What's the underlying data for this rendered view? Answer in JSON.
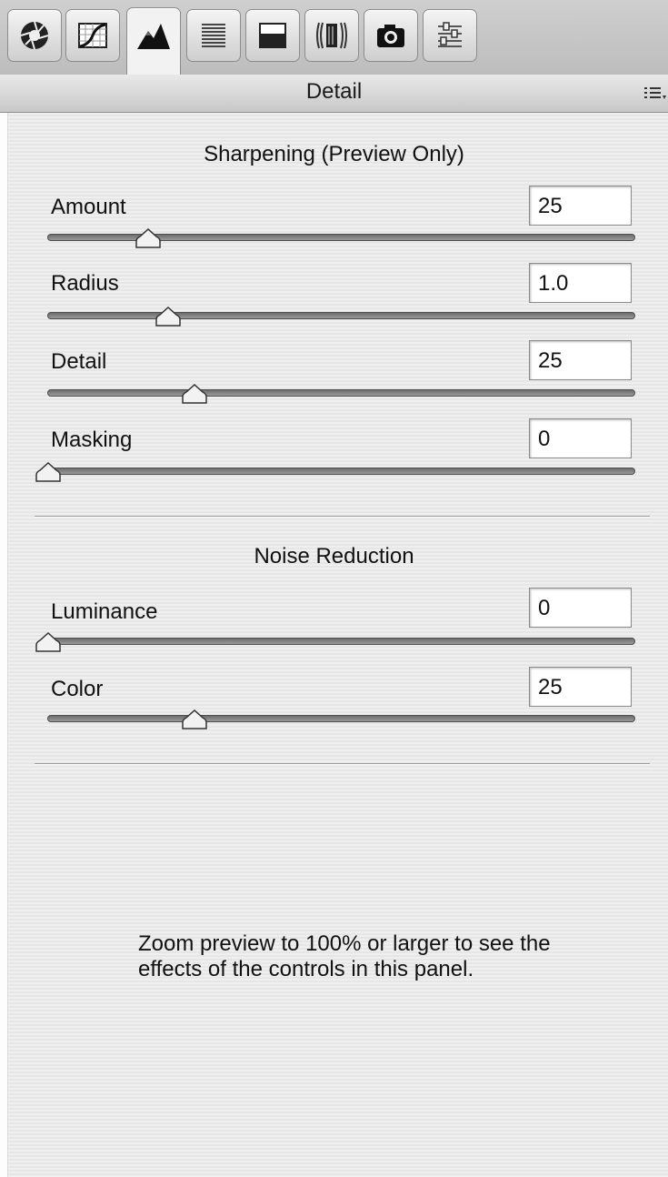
{
  "tabs": [
    {
      "name": "basic-tab",
      "icon": "aperture-icon"
    },
    {
      "name": "tone-curve-tab",
      "icon": "curve-icon"
    },
    {
      "name": "detail-tab",
      "icon": "mountain-icon",
      "active": true
    },
    {
      "name": "hsl-tab",
      "icon": "hsl-lines-icon"
    },
    {
      "name": "split-toning-tab",
      "icon": "split-toning-icon"
    },
    {
      "name": "lens-corrections-tab",
      "icon": "lens-icon"
    },
    {
      "name": "camera-calibration-tab",
      "icon": "camera-icon"
    },
    {
      "name": "presets-tab",
      "icon": "sliders-icon"
    }
  ],
  "header": {
    "title": "Detail",
    "menu_icon": "panel-menu-icon"
  },
  "sharpening": {
    "title": "Sharpening  (Preview Only)",
    "amount": {
      "label": "Amount",
      "value": "25",
      "fraction": 0.17
    },
    "radius": {
      "label": "Radius",
      "value": "1.0",
      "fraction": 0.205
    },
    "detail": {
      "label": "Detail",
      "value": "25",
      "fraction": 0.25
    },
    "masking": {
      "label": "Masking",
      "value": "0",
      "fraction": 0.0
    }
  },
  "noise_reduction": {
    "title": "Noise Reduction",
    "luminance": {
      "label": "Luminance",
      "value": "0",
      "fraction": 0.0
    },
    "color": {
      "label": "Color",
      "value": "25",
      "fraction": 0.25
    }
  },
  "info": {
    "text": "Zoom preview to 100% or larger to see the effects of the controls in this panel."
  }
}
